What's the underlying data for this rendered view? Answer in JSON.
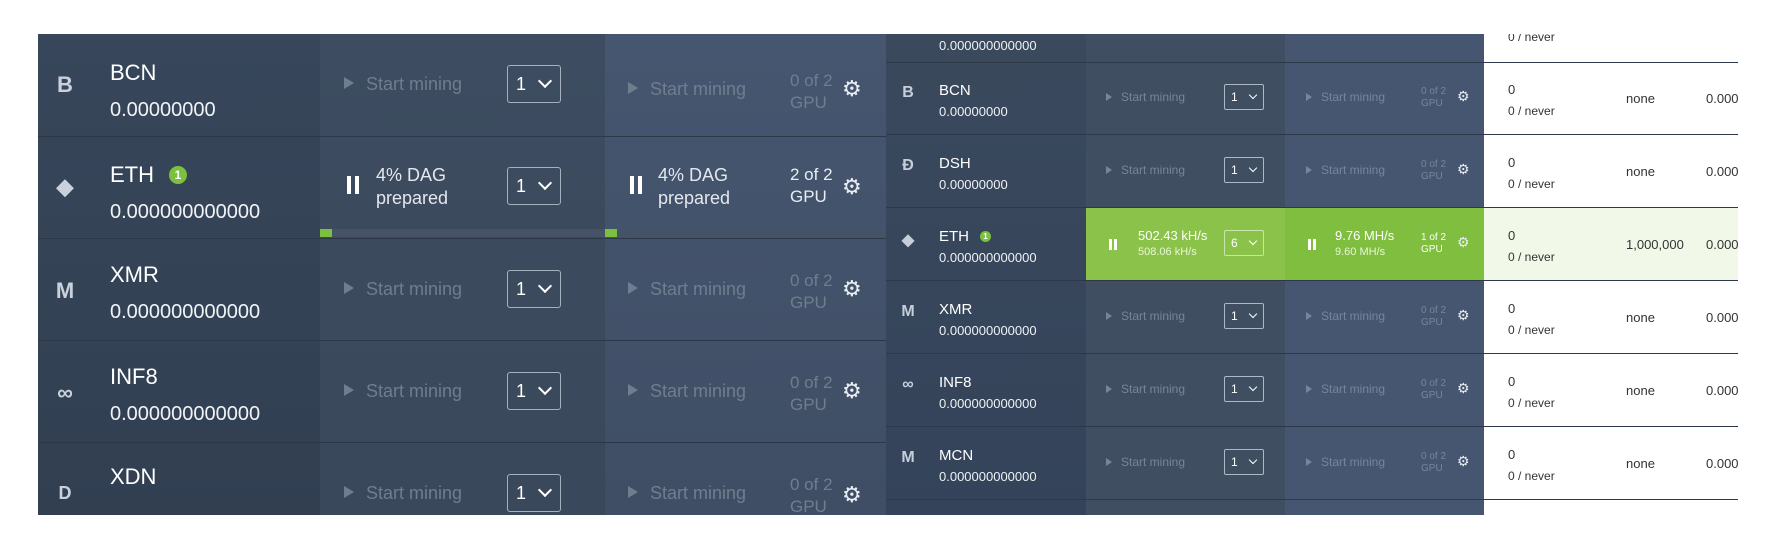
{
  "left_panel": {
    "rows": [
      {
        "symbol": "BCN",
        "icon": "bytecoin-icon",
        "glyph": "B",
        "balance": "0.00000000",
        "mining": false,
        "start_label": "Start mining",
        "threads": "1",
        "gpu": "0 of 2\nGPU"
      },
      {
        "symbol": "ETH",
        "icon": "ethereum-icon",
        "glyph": "◆",
        "balance": "0.000000000000",
        "badge": "1",
        "mining": true,
        "dag_label": "4% DAG\nprepared",
        "threads": "1",
        "gpu": "2 of 2\nGPU",
        "dag_progress": 0.04
      },
      {
        "symbol": "XMR",
        "icon": "monero-icon",
        "glyph": "M",
        "balance": "0.000000000000",
        "mining": false,
        "start_label": "Start mining",
        "threads": "1",
        "gpu": "0 of 2\nGPU"
      },
      {
        "symbol": "INF8",
        "icon": "infinity8-icon",
        "glyph": "∞",
        "balance": "0.000000000000",
        "mining": false,
        "start_label": "Start mining",
        "threads": "1",
        "gpu": "0 of 2\nGPU"
      },
      {
        "symbol": "XDN",
        "icon": "digitalnote-icon",
        "glyph": "D",
        "balance": "",
        "mining": false,
        "start_label": "Start mining",
        "threads": "1",
        "gpu": "0 of 2\nGPU"
      }
    ]
  },
  "right_panel": {
    "top_partial": {
      "balance": "0.000000000000",
      "stat": "0 / never"
    },
    "rows": [
      {
        "symbol": "BCN",
        "icon": "bytecoin-icon",
        "glyph": "B",
        "balance": "0.00000000",
        "mining": false,
        "start_label": "Start mining",
        "threads": "1",
        "gpu": "0 of 2\nGPU",
        "stat": "0",
        "last": "0 / never",
        "min": "none",
        "val": "0.000"
      },
      {
        "symbol": "DSH",
        "icon": "dash-icon",
        "glyph": "Đ",
        "balance": "0.00000000",
        "mining": false,
        "start_label": "Start mining",
        "threads": "1",
        "gpu": "0 of 2\nGPU",
        "stat": "0",
        "last": "0 / never",
        "min": "none",
        "val": "0.000"
      },
      {
        "symbol": "ETH",
        "icon": "ethereum-icon",
        "glyph": "◆",
        "badge": "1",
        "balance": "0.000000000000",
        "mining": true,
        "cpu_rate": "502.43 kH/s",
        "cpu_rate_avg": "508.06 kH/s",
        "threads": "6",
        "gpu_rate": "9.76 MH/s",
        "gpu_rate_avg": "9.60 MH/s",
        "gpu": "1 of 2\nGPU",
        "stat": "0",
        "last": "0 / never",
        "min": "1,000,000",
        "val": "0.000"
      },
      {
        "symbol": "XMR",
        "icon": "monero-icon",
        "glyph": "M",
        "balance": "0.000000000000",
        "mining": false,
        "start_label": "Start mining",
        "threads": "1",
        "gpu": "0 of 2\nGPU",
        "stat": "0",
        "last": "0 / never",
        "min": "none",
        "val": "0.000"
      },
      {
        "symbol": "INF8",
        "icon": "infinity8-icon",
        "glyph": "∞",
        "balance": "0.000000000000",
        "mining": false,
        "start_label": "Start mining",
        "threads": "1",
        "gpu": "0 of 2\nGPU",
        "stat": "0",
        "last": "0 / never",
        "min": "none",
        "val": "0.000"
      },
      {
        "symbol": "MCN",
        "icon": "moneta-icon",
        "glyph": "M",
        "balance": "0.000000000000",
        "mining": false,
        "start_label": "Start mining",
        "threads": "1",
        "gpu": "0 of 2\nGPU",
        "stat": "0",
        "last": "0 / never",
        "min": "none",
        "val": "0.000"
      }
    ]
  },
  "colors": {
    "accent_green": "#7cc040",
    "mining_green": "#8bc34a",
    "panel_dark": "#34435a"
  }
}
